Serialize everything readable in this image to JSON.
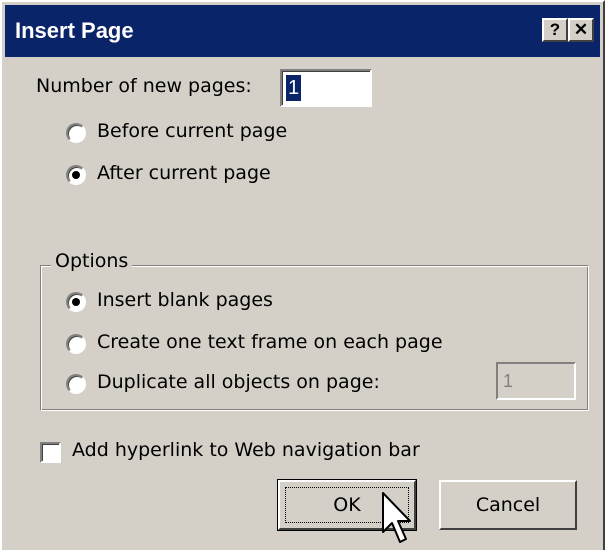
{
  "dialog": {
    "title": "Insert Page",
    "help_button": "?",
    "close_button": "✕"
  },
  "num_pages": {
    "label": "Number of new pages:",
    "value": "1"
  },
  "position": {
    "options": [
      {
        "label": "Before current page",
        "selected": false
      },
      {
        "label": "After current page",
        "selected": true
      }
    ]
  },
  "options_group": {
    "legend": "Options",
    "items": [
      {
        "label": "Insert blank pages",
        "selected": true
      },
      {
        "label": "Create one text frame on each page",
        "selected": false
      },
      {
        "label": "Duplicate all objects on page:",
        "selected": false
      }
    ],
    "duplicate_page_value": "1"
  },
  "hyperlink": {
    "label": "Add hyperlink to Web navigation bar",
    "checked": false
  },
  "buttons": {
    "ok": "OK",
    "cancel": "Cancel"
  }
}
